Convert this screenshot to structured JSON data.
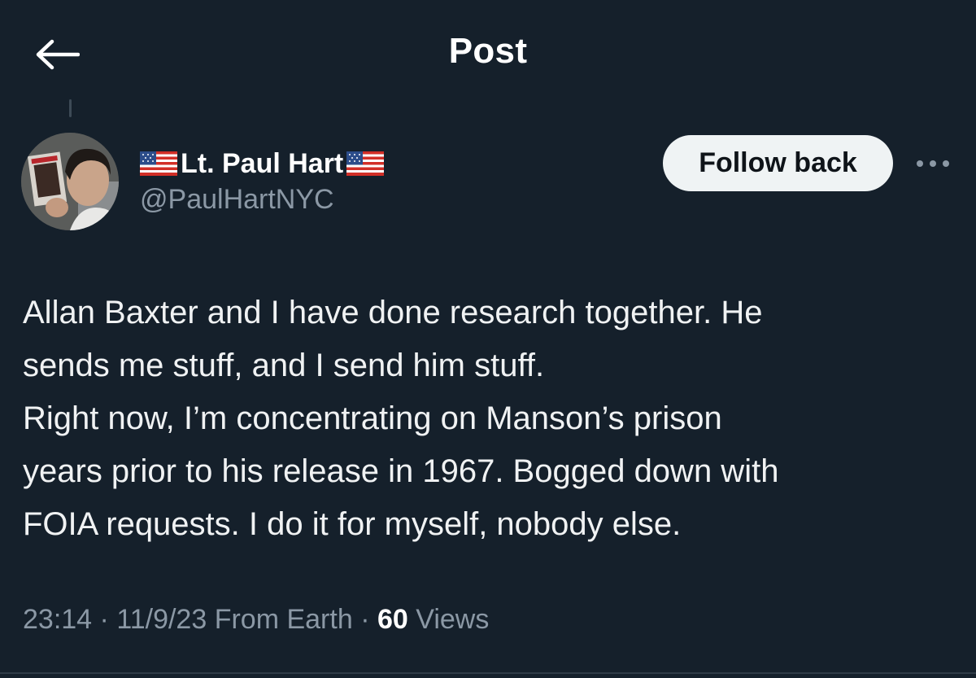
{
  "header": {
    "title": "Post",
    "back_icon": "arrow-left-icon"
  },
  "author": {
    "display_name": "Lt. Paul Hart",
    "handle": "@PaulHartNYC",
    "name_prefix_emoji": "us-flag-icon",
    "name_suffix_emoji": "us-flag-icon"
  },
  "actions": {
    "follow_label": "Follow back",
    "more_icon": "more-horizontal-icon"
  },
  "post": {
    "text": "Allan Baxter and I have done research together. He\nsends me stuff, and I send him stuff.\nRight now, I’m concentrating on Manson’s prison\nyears prior to his release in 1967. Bogged down with\nFOIA requests. I do it for myself, nobody else."
  },
  "meta": {
    "time": "23:14",
    "date": "11/9/23",
    "source": "From Earth",
    "separator": "·",
    "views_count": "60",
    "views_label": "Views"
  },
  "colors": {
    "background": "#15202b",
    "text_primary": "#ffffff",
    "text_secondary": "#8b98a5",
    "button_bg": "#eff3f4"
  }
}
